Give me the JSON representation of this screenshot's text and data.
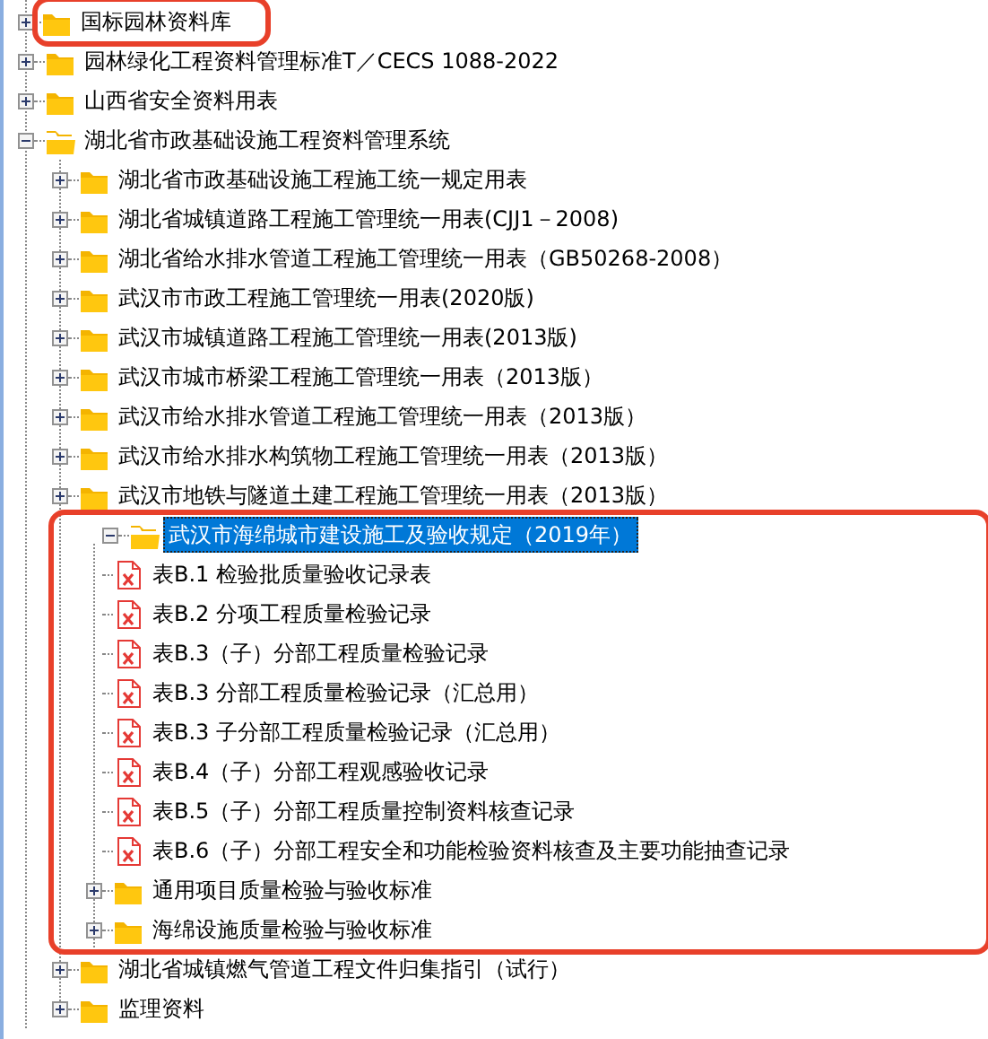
{
  "tree": [
    {
      "label": "国标园林资料库",
      "kind": "folder",
      "expanded": false,
      "selected": false,
      "highlighted": true
    },
    {
      "label": "园林绿化工程资料管理标准T／CECS 1088-2022",
      "kind": "folder",
      "expanded": false,
      "selected": false,
      "highlighted": false
    },
    {
      "label": "山西省安全资料用表",
      "kind": "folder",
      "expanded": false,
      "selected": false,
      "highlighted": false
    },
    {
      "label": "湖北省市政基础设施工程资料管理系统",
      "kind": "folder",
      "expanded": true,
      "selected": false,
      "highlighted": false,
      "children": [
        {
          "label": "湖北省市政基础设施工程施工统一规定用表",
          "kind": "folder",
          "expanded": false,
          "selected": false,
          "highlighted": false
        },
        {
          "label": "湖北省城镇道路工程施工管理统一用表(CJJ1－2008)",
          "kind": "folder",
          "expanded": false,
          "selected": false,
          "highlighted": false
        },
        {
          "label": "湖北省给水排水管道工程施工管理统一用表（GB50268-2008）",
          "kind": "folder",
          "expanded": false,
          "selected": false,
          "highlighted": false
        },
        {
          "label": "武汉市市政工程施工管理统一用表(2020版)",
          "kind": "folder",
          "expanded": false,
          "selected": false,
          "highlighted": false
        },
        {
          "label": "武汉市城镇道路工程施工管理统一用表(2013版)",
          "kind": "folder",
          "expanded": false,
          "selected": false,
          "highlighted": false
        },
        {
          "label": "武汉市城市桥梁工程施工管理统一用表（2013版）",
          "kind": "folder",
          "expanded": false,
          "selected": false,
          "highlighted": false
        },
        {
          "label": "武汉市给水排水管道工程施工管理统一用表（2013版）",
          "kind": "folder",
          "expanded": false,
          "selected": false,
          "highlighted": false
        },
        {
          "label": "武汉市给水排水构筑物工程施工管理统一用表（2013版）",
          "kind": "folder",
          "expanded": false,
          "selected": false,
          "highlighted": false
        },
        {
          "label": "武汉市地铁与隧道土建工程施工管理统一用表（2013版）",
          "kind": "folder",
          "expanded": false,
          "selected": false,
          "highlighted": false
        },
        {
          "label": "武汉市海绵城市建设施工及验收规定（2019年）",
          "kind": "folder",
          "expanded": true,
          "selected": true,
          "highlighted": true,
          "children": [
            {
              "label": "表B.1 检验批质量验收记录表",
              "kind": "file",
              "selected": false,
              "highlighted": false
            },
            {
              "label": "表B.2 分项工程质量检验记录",
              "kind": "file",
              "selected": false,
              "highlighted": false
            },
            {
              "label": "表B.3（子）分部工程质量检验记录",
              "kind": "file",
              "selected": false,
              "highlighted": false
            },
            {
              "label": "表B.3 分部工程质量检验记录（汇总用）",
              "kind": "file",
              "selected": false,
              "highlighted": false
            },
            {
              "label": "表B.3 子分部工程质量检验记录（汇总用）",
              "kind": "file",
              "selected": false,
              "highlighted": false
            },
            {
              "label": "表B.4（子）分部工程观感验收记录",
              "kind": "file",
              "selected": false,
              "highlighted": false
            },
            {
              "label": "表B.5（子）分部工程质量控制资料核查记录",
              "kind": "file",
              "selected": false,
              "highlighted": false
            },
            {
              "label": "表B.6（子）分部工程安全和功能检验资料核查及主要功能抽查记录",
              "kind": "file",
              "selected": false,
              "highlighted": false
            },
            {
              "label": "通用项目质量检验与验收标准",
              "kind": "folder",
              "expanded": false,
              "selected": false,
              "highlighted": false
            },
            {
              "label": "海绵设施质量检验与验收标准",
              "kind": "folder",
              "expanded": false,
              "selected": false,
              "highlighted": false
            }
          ]
        },
        {
          "label": "湖北省城镇燃气管道工程文件归集指引（试行）",
          "kind": "folder",
          "expanded": false,
          "selected": false,
          "highlighted": false
        },
        {
          "label": "监理资料",
          "kind": "folder",
          "expanded": false,
          "selected": false,
          "highlighted": false
        }
      ]
    }
  ]
}
